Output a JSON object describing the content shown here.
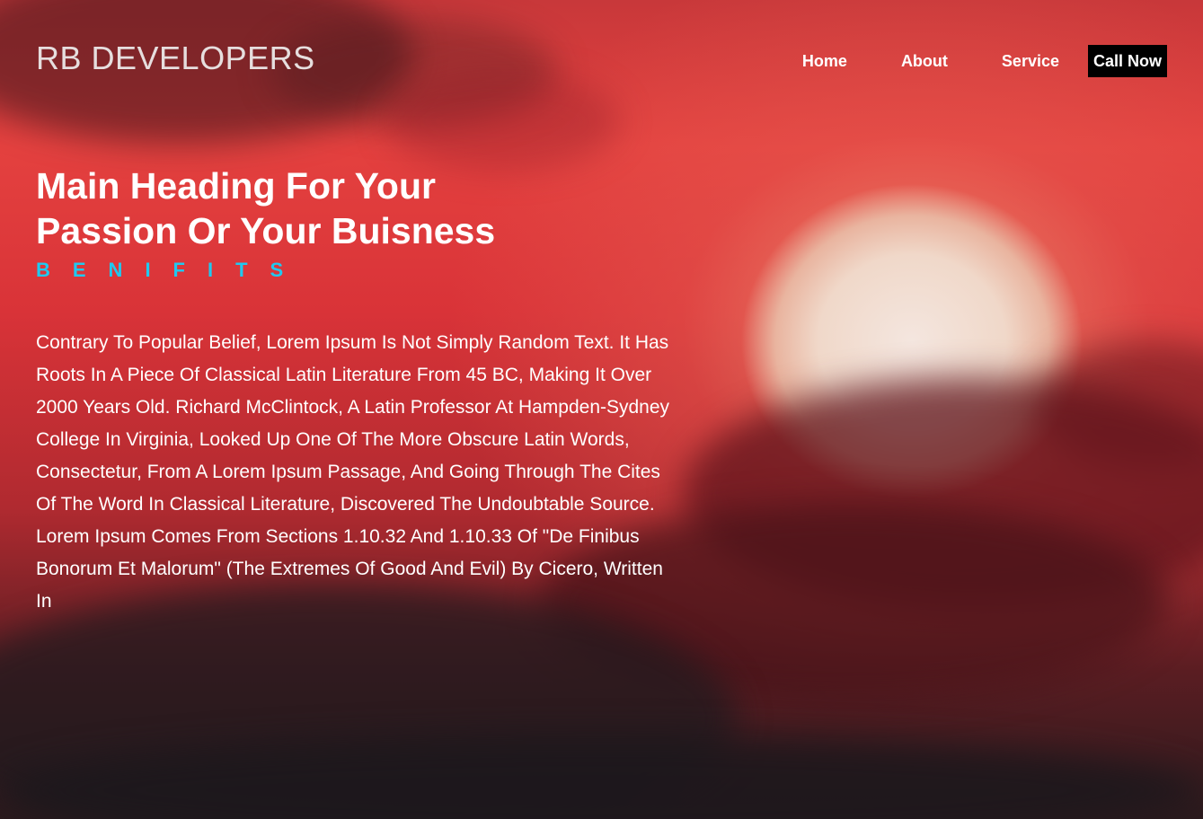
{
  "header": {
    "logo": "RB DEVELOPERS",
    "nav": {
      "home": "Home",
      "about": "About",
      "service": "Service",
      "call_now": "Call Now"
    }
  },
  "hero": {
    "heading_line1": "Main Heading For Your",
    "heading_line2": "Passion Or Your Buisness",
    "subheading": "BENIFITS",
    "body": "Contrary To Popular Belief, Lorem Ipsum Is Not Simply Random Text. It Has Roots In A Piece Of Classical Latin Literature From 45 BC, Making It Over 2000 Years Old. Richard McClintock, A Latin Professor At Hampden-Sydney College In Virginia, Looked Up One Of The More Obscure Latin Words, Consectetur, From A Lorem Ipsum Passage, And Going Through The Cites Of The Word In Classical Literature, Discovered The Undoubtable Source. Lorem Ipsum Comes From Sections 1.10.32 And 1.10.33 Of \"De Finibus Bonorum Et Malorum\" (The Extremes Of Good And Evil) By Cicero, Written In"
  },
  "colors": {
    "accent": "#1fc9f0",
    "call_button_bg": "#000000",
    "text": "#ffffff"
  }
}
